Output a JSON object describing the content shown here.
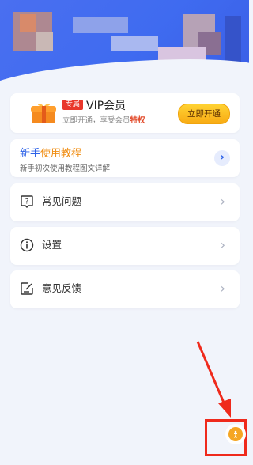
{
  "vip": {
    "badge": "专属",
    "title": "VIP会员",
    "subtitle_prefix": "立即开通，享受会员",
    "subtitle_highlight": "特权",
    "button": "立即开通"
  },
  "tutorial": {
    "title_part1": "新手",
    "title_part2": "使用教程",
    "subtitle": "新手初次使用教程图文详解"
  },
  "menu": [
    {
      "label": "常见问题",
      "icon": "help-icon"
    },
    {
      "label": "设置",
      "icon": "info-icon"
    },
    {
      "label": "意见反馈",
      "icon": "feedback-icon"
    }
  ],
  "colors": {
    "header": "#4a6ff0",
    "accent_blue": "#2c62e8",
    "accent_orange": "#f08d12",
    "vip_button": "#f8ab14",
    "highlight_red": "#ef2a1c"
  }
}
